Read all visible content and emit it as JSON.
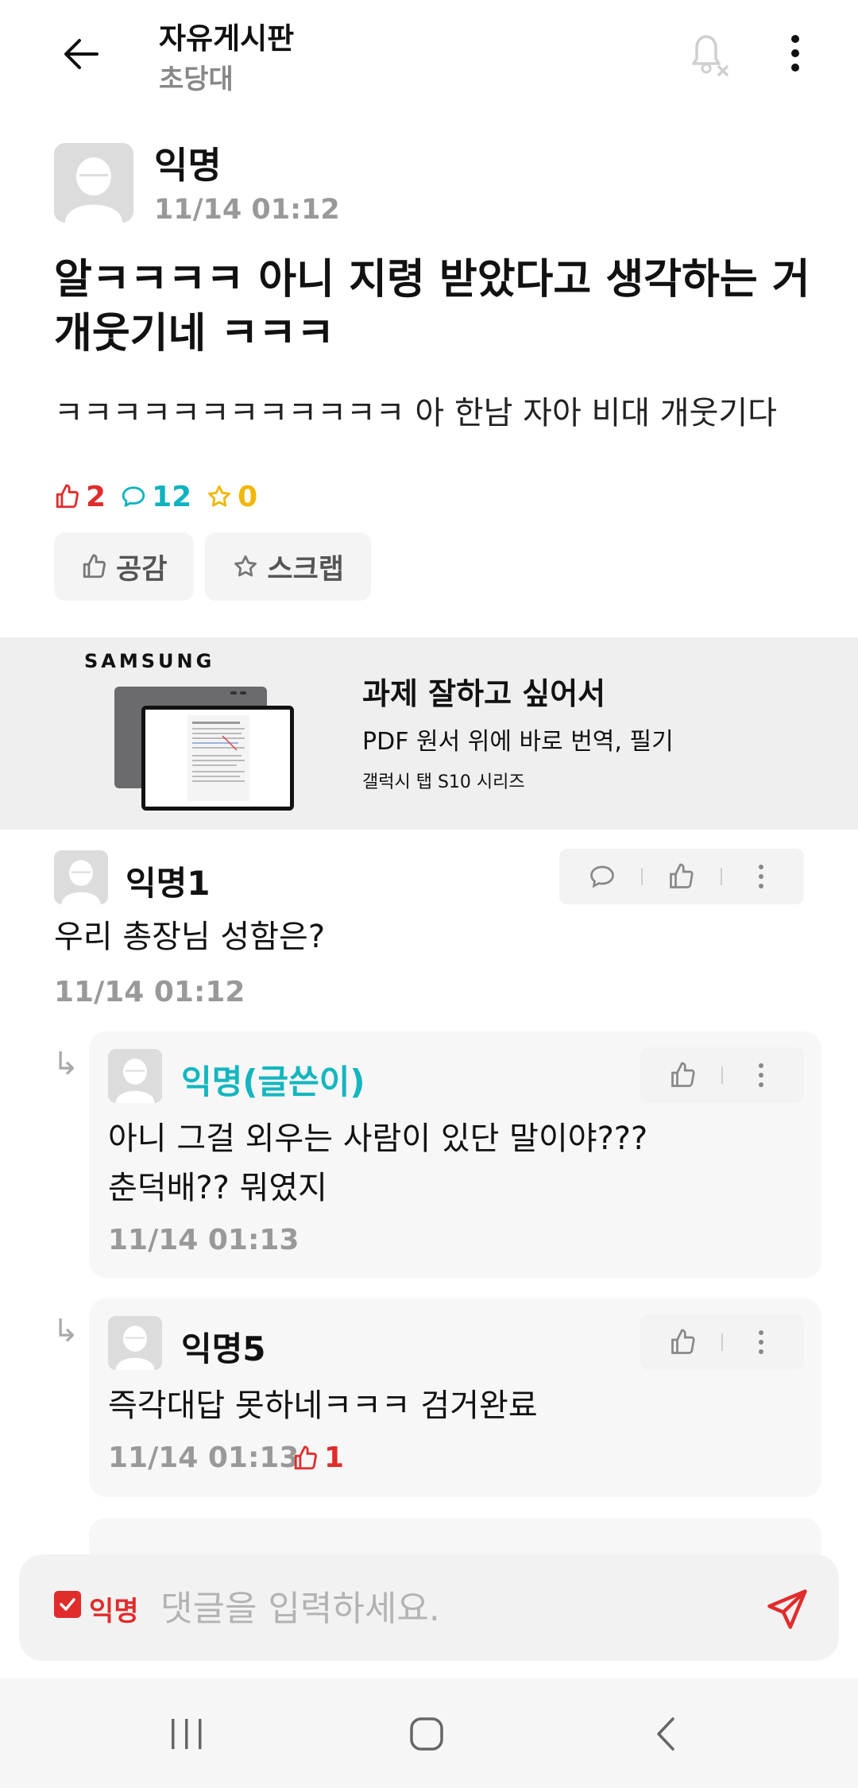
{
  "header": {
    "title": "자유게시판",
    "subtitle": "초당대"
  },
  "post": {
    "author": "익명",
    "time": "11/14 01:12",
    "title": "알ㅋㅋㅋㅋ 아니 지령 받았다고 생각하는 거 개웃기네 ㅋㅋㅋ",
    "body": "ㅋㅋㅋㅋㅋㅋㅋㅋㅋㅋㅋㅋ 아 한남 자아 비대 개웃기다",
    "stats": {
      "likes": "2",
      "comments": "12",
      "scraps": "0"
    },
    "buttons": {
      "like": "공감",
      "scrap": "스크랩"
    }
  },
  "ad": {
    "brand": "SAMSUNG",
    "title": "과제 잘하고 싶어서",
    "line2": "PDF 원서 위에 바로 번역, 필기",
    "line3": "갤럭시 탭 S10 시리즈"
  },
  "comments": [
    {
      "author": "익명1",
      "text": "우리 총장님 성함은?",
      "time": "11/14 01:12"
    }
  ],
  "replies": [
    {
      "author": "익명(글쓴이)",
      "text_line1": "아니 그걸 외우는 사람이 있단 말이야???",
      "text_line2": "춘덕배?? 뭐였지",
      "time": "11/14 01:13"
    },
    {
      "author": "익명5",
      "text_line1": "즉각대답 못하네ㅋㅋㅋ 검거완료",
      "time": "11/14 01:13",
      "likes": "1"
    }
  ],
  "input": {
    "anon_label": "익명",
    "placeholder": "댓글을 입력하세요."
  },
  "colors": {
    "like": "#e12c2c",
    "comment": "#0fb3c0",
    "scrap": "#f2b705",
    "op": "#14b6bf"
  }
}
